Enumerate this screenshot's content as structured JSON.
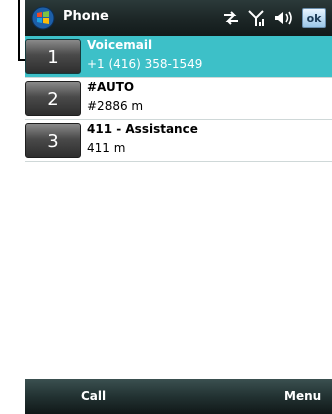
{
  "titlebar": {
    "title": "Phone",
    "ok_label": "ok",
    "icons": [
      "windows-start-icon",
      "connectivity-icon",
      "signal-icon",
      "volume-icon"
    ]
  },
  "speed_dial": [
    {
      "key": "1",
      "name": "Voicemail",
      "detail": "+1 (416) 358-1549",
      "selected": true
    },
    {
      "key": "2",
      "name": "#AUTO",
      "detail": "#2886 m",
      "selected": false
    },
    {
      "key": "3",
      "name": "411 - Assistance",
      "detail": "411 m",
      "selected": false
    }
  ],
  "softkeys": {
    "left": "Call",
    "right": "Menu"
  },
  "colors": {
    "selection": "#3dc0c8",
    "bar": "#1c2626"
  }
}
